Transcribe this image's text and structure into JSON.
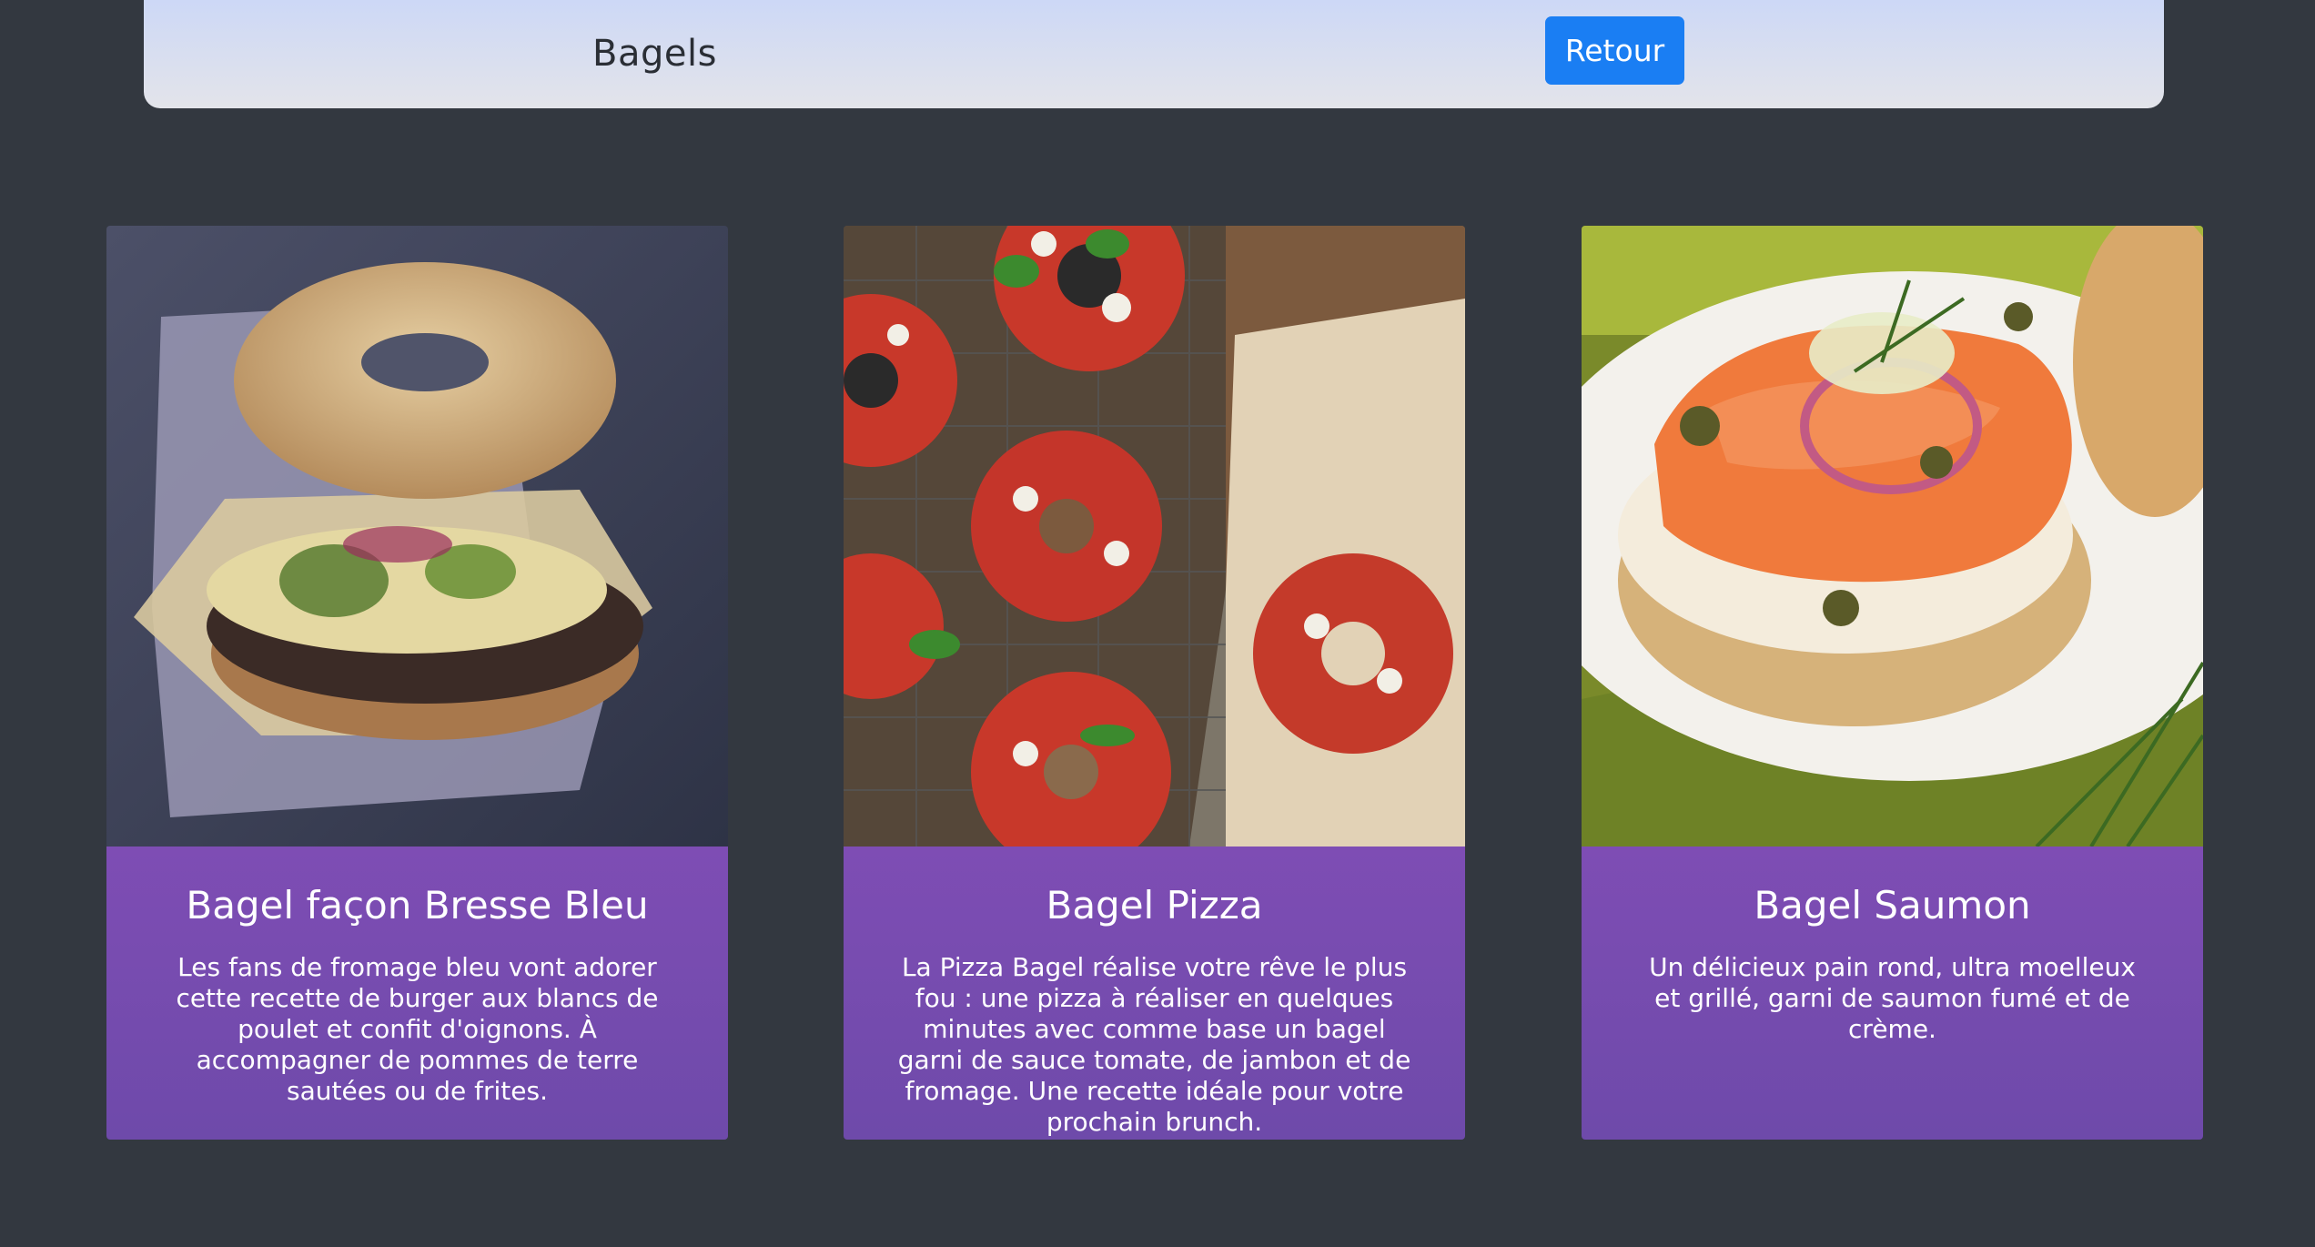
{
  "header": {
    "title": "Bagels",
    "back_label": "Retour"
  },
  "colors": {
    "page_background": "#333840",
    "header_gradient_top": "#c9d6f8",
    "header_gradient_bottom": "#e3e4ea",
    "button_blue": "#1a7ef3",
    "card_purple": "#7650b0"
  },
  "cards": [
    {
      "title": "Bagel façon Bresse Bleu",
      "description": "Les fans de fromage bleu vont adorer cette recette de burger aux blancs de poulet et confit d'oignons. À accompagner de pommes de terre sautées ou de frites.",
      "image": "bagel-bresse-bleu-photo"
    },
    {
      "title": "Bagel Pizza",
      "description": "La Pizza Bagel réalise votre rêve le plus fou : une pizza à réaliser en quelques minutes avec comme base un bagel garni de sauce tomate, de jambon et de fromage. Une recette idéale pour votre prochain brunch.",
      "image": "bagel-pizza-photo"
    },
    {
      "title": "Bagel Saumon",
      "description": "Un délicieux pain rond, ultra moelleux et grillé, garni de saumon fumé et de crème.",
      "image": "bagel-saumon-photo"
    }
  ]
}
